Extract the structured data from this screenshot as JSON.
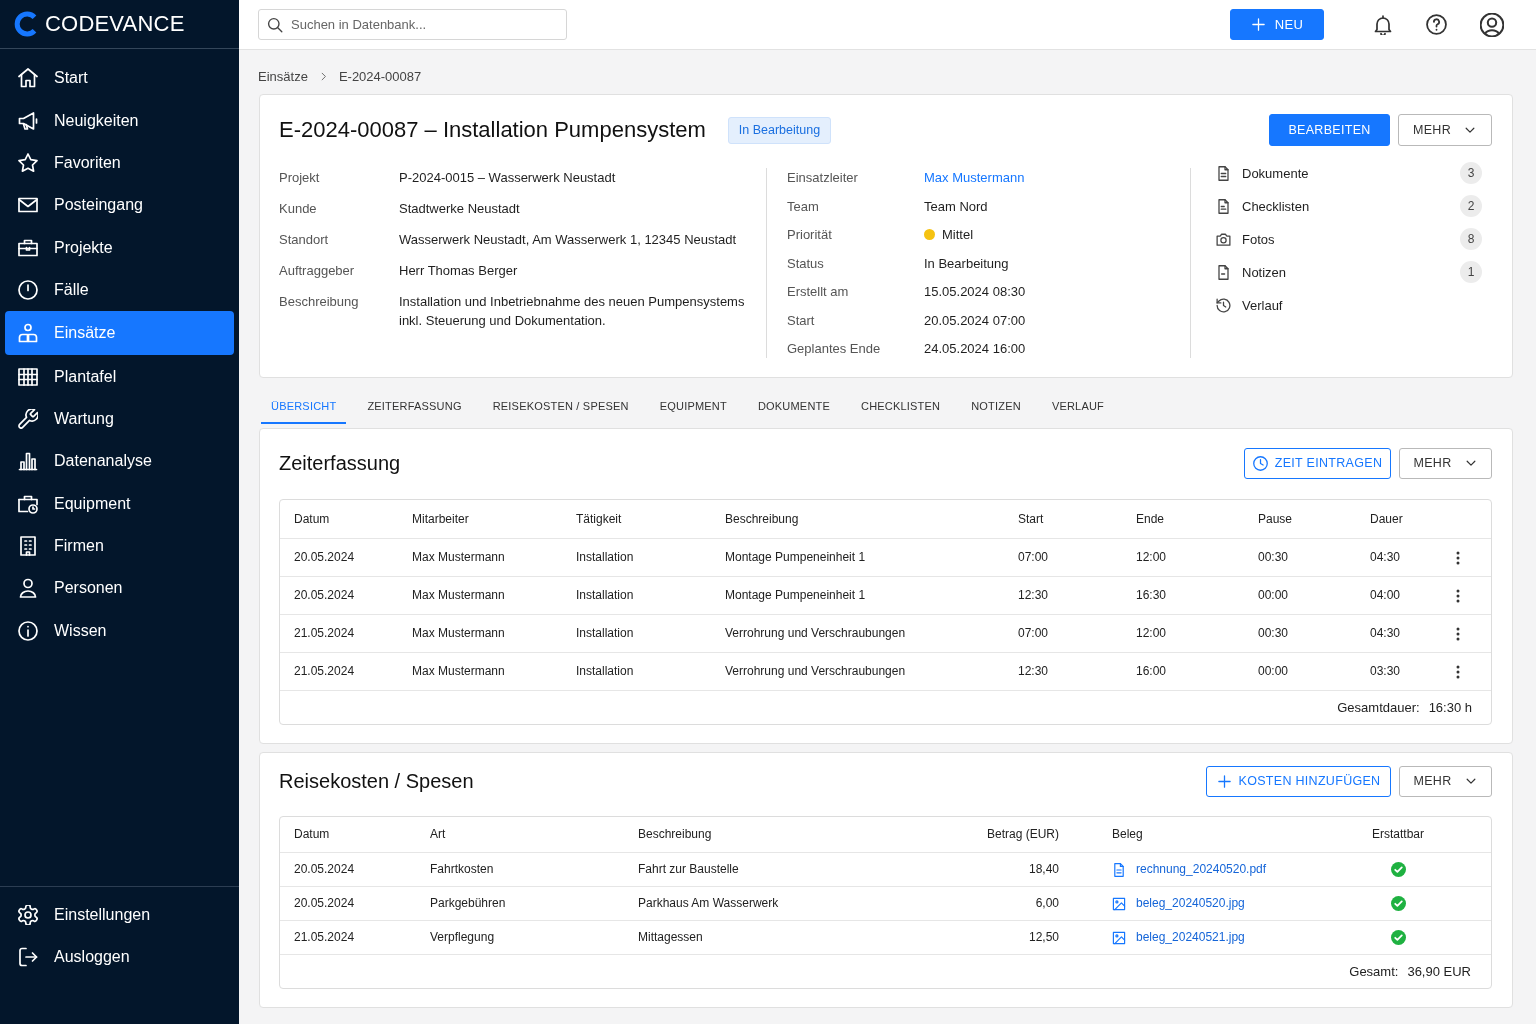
{
  "sidebar": {
    "brand": "CODEVANCE",
    "items": [
      {
        "label": "Start",
        "selected": false
      },
      {
        "label": "Neuigkeiten",
        "selected": false
      },
      {
        "label": "Favoriten",
        "selected": false
      },
      {
        "label": "Posteingang",
        "selected": false
      },
      {
        "label": "Projekte",
        "selected": false
      },
      {
        "label": "Fälle",
        "selected": false
      },
      {
        "label": "Einsätze",
        "selected": true
      },
      {
        "label": "Plantafel",
        "selected": false
      },
      {
        "label": "Wartung",
        "selected": false
      },
      {
        "label": "Datenanalyse",
        "selected": false
      },
      {
        "label": "Equipment",
        "selected": false
      },
      {
        "label": "Firmen",
        "selected": false
      },
      {
        "label": "Personen",
        "selected": false
      },
      {
        "label": "Wissen",
        "selected": false
      }
    ],
    "footer_items": [
      {
        "label": "Einstellungen"
      },
      {
        "label": "Ausloggen"
      }
    ]
  },
  "topbar": {
    "search": {
      "placeholder": "Suchen in Datenbank..."
    },
    "new_button": "NEU"
  },
  "breadcrumb": [
    {
      "label": "Einsätze"
    },
    {
      "label": "E-2024-00087"
    }
  ],
  "header": {
    "title": "E-2024-00087 – Installation Pumpensystem",
    "status_badge": "In Bearbeitung",
    "edit_button": "BEARBEITEN",
    "more_button": "MEHR",
    "details_left": [
      {
        "label": "Projekt",
        "value": "P-2024-0015 – Wasserwerk Neustadt"
      },
      {
        "label": "Kunde",
        "value": "Stadtwerke Neustadt"
      },
      {
        "label": "Standort",
        "value": "Wasserwerk Neustadt, Am Wasserwerk 1, 12345 Neustadt"
      },
      {
        "label": "Auftraggeber",
        "value": "Herr Thomas Berger"
      },
      {
        "label": "Beschreibung",
        "value": "Installation und Inbetriebnahme des neuen Pumpensystems inkl. Steuerung und Dokumentation."
      }
    ],
    "details_middle": [
      {
        "label": "Einsatzleiter",
        "value": "Max Mustermann",
        "kind": "link"
      },
      {
        "label": "Team",
        "value": "Team Nord",
        "kind": "text"
      },
      {
        "label": "Priorität",
        "value": "Mittel",
        "kind": "priority",
        "color": "#f5c211"
      },
      {
        "label": "Status",
        "value": "In Bearbeitung",
        "kind": "text"
      },
      {
        "label": "Erstellt am",
        "value": "15.05.2024 08:30",
        "kind": "text"
      },
      {
        "label": "Start",
        "value": "20.05.2024 07:00",
        "kind": "text"
      },
      {
        "label": "Geplantes Ende",
        "value": "24.05.2024 16:00",
        "kind": "text"
      }
    ],
    "attachments": [
      {
        "label": "Dokumente",
        "count": "3"
      },
      {
        "label": "Checklisten",
        "count": "2"
      },
      {
        "label": "Fotos",
        "count": "8"
      },
      {
        "label": "Notizen",
        "count": "1"
      },
      {
        "label": "Verlauf"
      }
    ]
  },
  "tabs": [
    {
      "label": "ÜBERSICHT",
      "selected": true
    },
    {
      "label": "ZEITERFASSUNG",
      "selected": false
    },
    {
      "label": "REISEKOSTEN / SPESEN",
      "selected": false
    },
    {
      "label": "EQUIPMENT",
      "selected": false
    },
    {
      "label": "DOKUMENTE",
      "selected": false
    },
    {
      "label": "CHECKLISTEN",
      "selected": false
    },
    {
      "label": "NOTIZEN",
      "selected": false
    },
    {
      "label": "VERLAUF",
      "selected": false
    }
  ],
  "time_tracking": {
    "title": "Zeiterfassung",
    "add_button": "ZEIT EINTRAGEN",
    "more_button": "MEHR",
    "columns": [
      "Datum",
      "Mitarbeiter",
      "Tätigkeit",
      "Beschreibung",
      "Start",
      "Ende",
      "Pause",
      "Dauer"
    ],
    "rows": [
      [
        "20.05.2024",
        "Max Mustermann",
        "Installation",
        "Montage Pumpeneinheit 1",
        "07:00",
        "12:00",
        "00:30",
        "04:30"
      ],
      [
        "20.05.2024",
        "Max Mustermann",
        "Installation",
        "Montage Pumpeneinheit 1",
        "12:30",
        "16:30",
        "00:00",
        "04:00"
      ],
      [
        "21.05.2024",
        "Max Mustermann",
        "Installation",
        "Verrohrung und Verschraubungen",
        "07:00",
        "12:00",
        "00:30",
        "04:30"
      ],
      [
        "21.05.2024",
        "Max Mustermann",
        "Installation",
        "Verrohrung und Verschraubungen",
        "12:30",
        "16:00",
        "00:00",
        "03:30"
      ]
    ],
    "total_label": "Gesamtdauer:",
    "total_value": "16:30 h"
  },
  "expenses": {
    "title": "Reisekosten / Spesen",
    "add_button": "KOSTEN HINZUFÜGEN",
    "more_button": "MEHR",
    "columns": [
      "Datum",
      "Art",
      "Beschreibung",
      "Betrag (EUR)",
      "Beleg",
      "Erstattbar"
    ],
    "rows": [
      {
        "date": "20.05.2024",
        "type": "Fahrtkosten",
        "description": "Fahrt zur Baustelle",
        "amount": "18,40",
        "receipt": {
          "file": "rechnung_20240520.pdf",
          "kind": "pdf"
        },
        "refundable": true
      },
      {
        "date": "20.05.2024",
        "type": "Parkgebühren",
        "description": "Parkhaus Am Wasserwerk",
        "amount": "6,00",
        "receipt": {
          "file": "beleg_20240520.jpg",
          "kind": "image"
        },
        "refundable": true
      },
      {
        "date": "21.05.2024",
        "type": "Verpflegung",
        "description": "Mittagessen",
        "amount": "12,50",
        "receipt": {
          "file": "beleg_20240521.jpg",
          "kind": "image"
        },
        "refundable": true
      }
    ],
    "total_label": "Gesamt:",
    "total_value": "36,90 EUR"
  }
}
